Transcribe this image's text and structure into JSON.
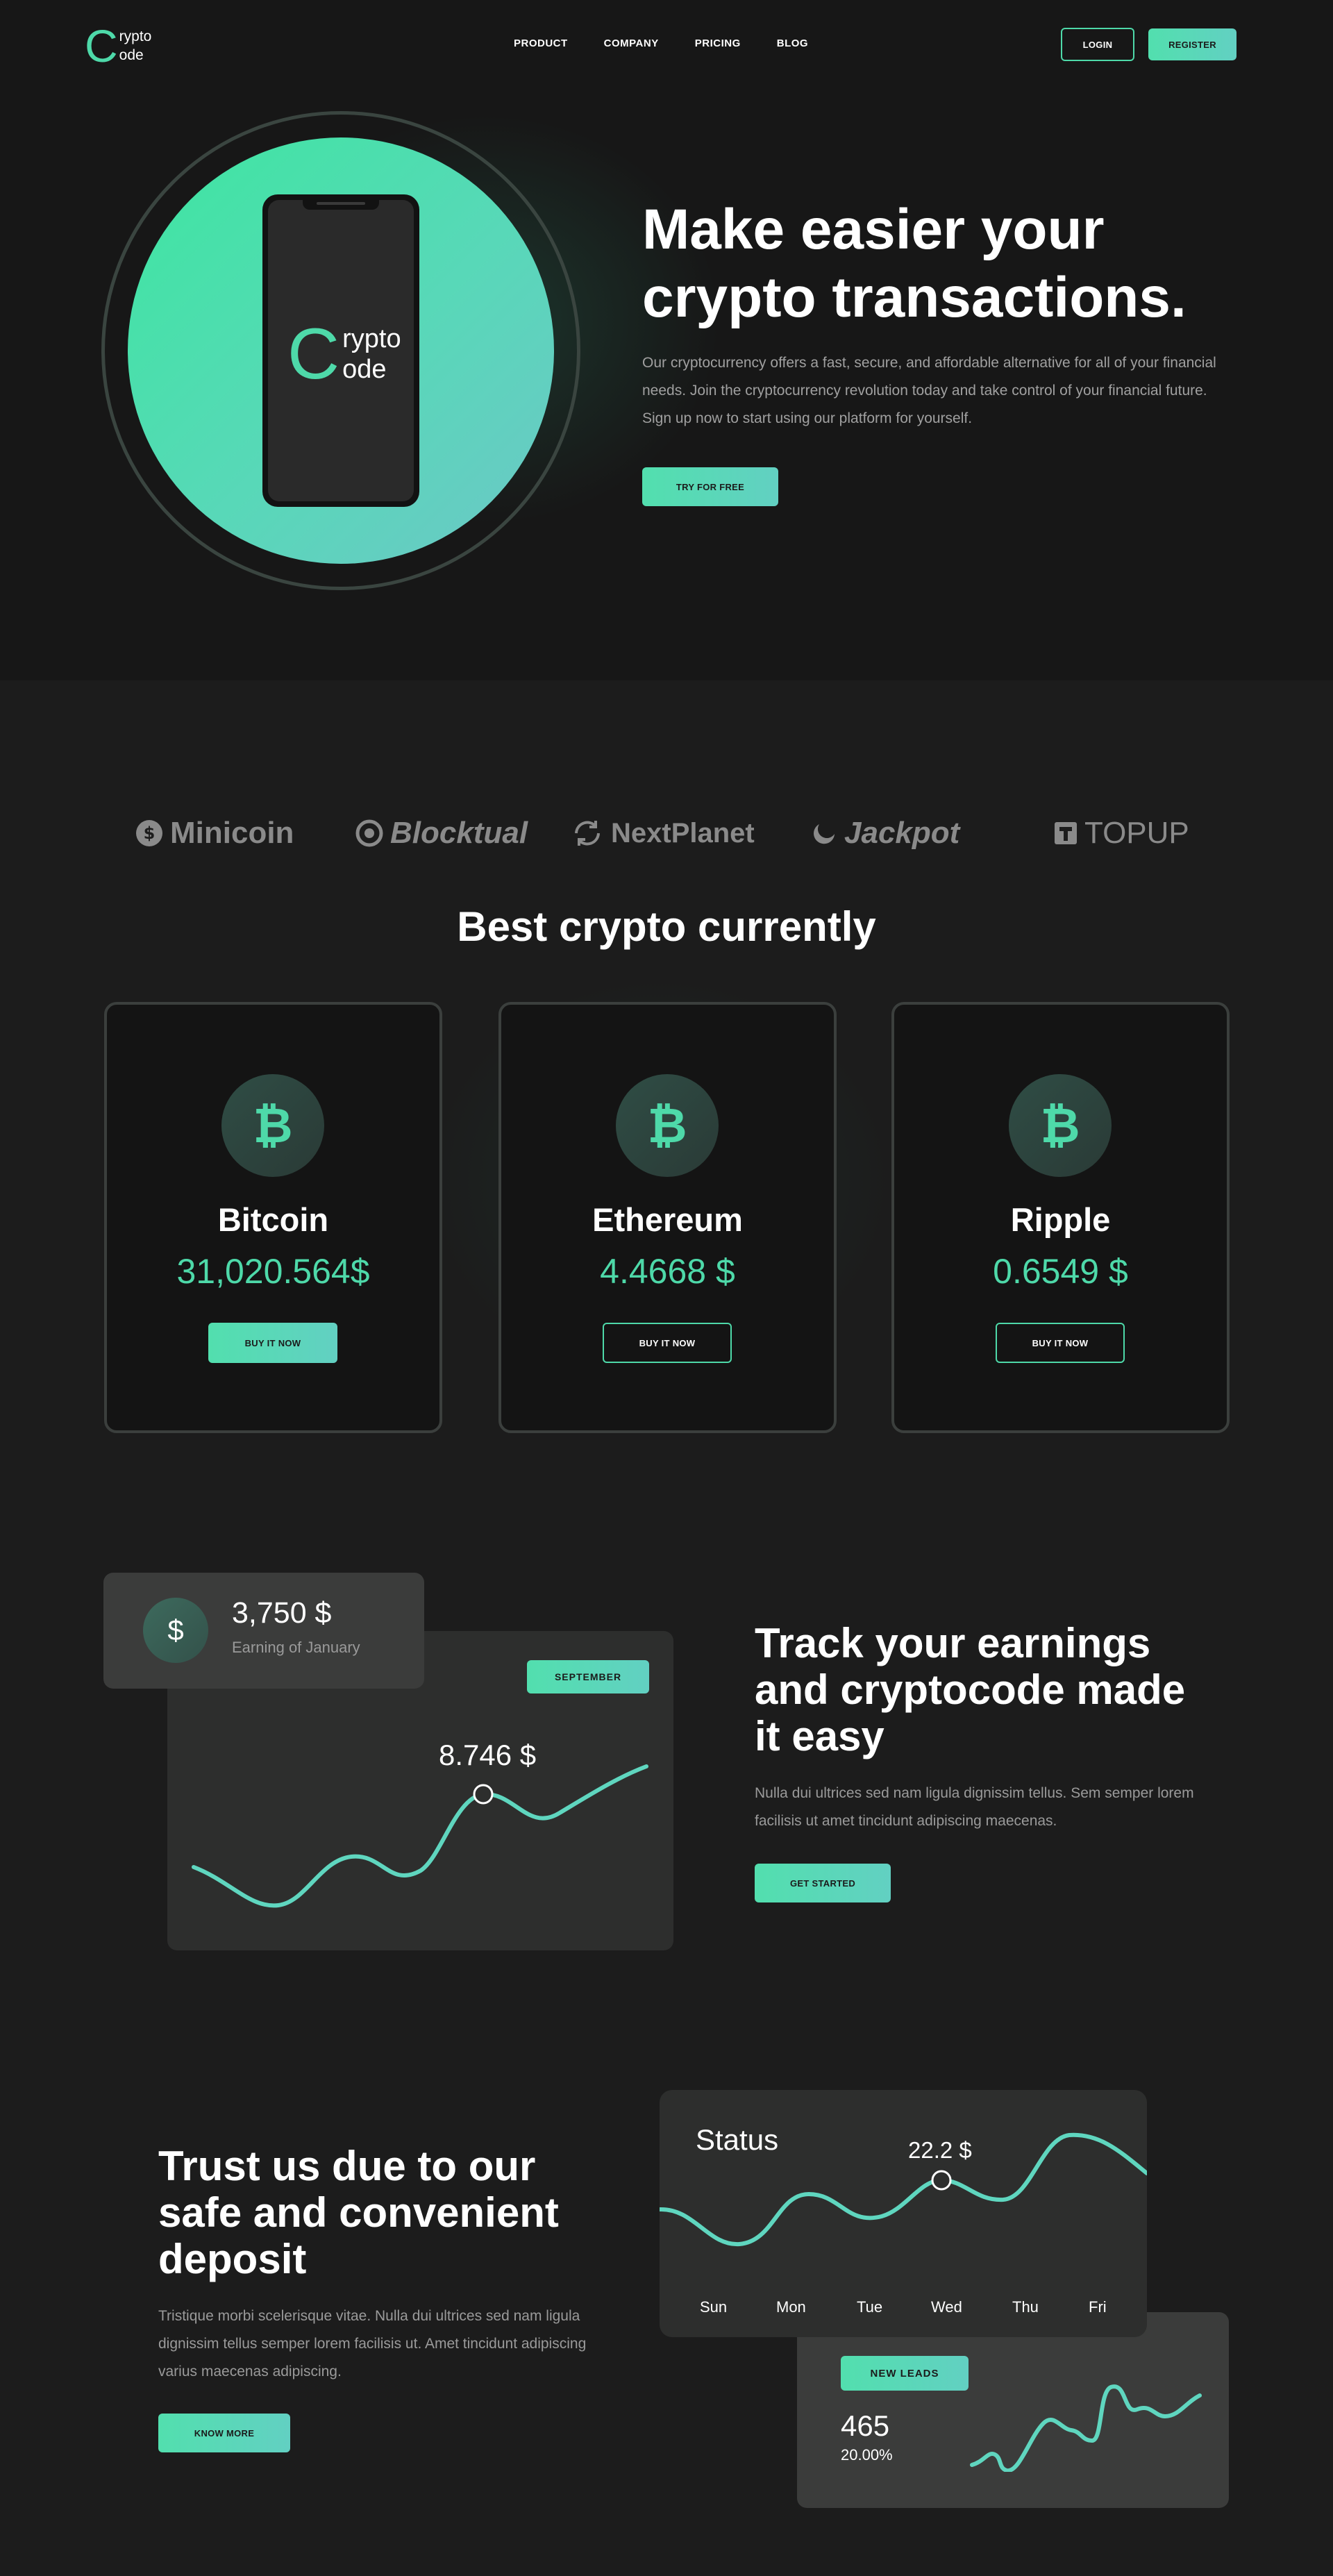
{
  "header": {
    "logo_letter": "C",
    "logo_line1": "rypto",
    "logo_line2": "ode",
    "nav": [
      "PRODUCT",
      "COMPANY",
      "PRICING",
      "BLOG"
    ],
    "login_label": "LOGIN",
    "register_label": "REGISTER"
  },
  "hero": {
    "title_line1": "Make easier your",
    "title_line2": "crypto transactions.",
    "description": "Our cryptocurrency offers a fast, secure, and affordable alternative for all of your financial needs. Join the cryptocurrency revolution today and take control of your financial future. Sign up now to start using our platform for yourself.",
    "cta_label": "TRY FOR FREE",
    "phone_logo_letter": "C",
    "phone_logo_line1": "rypto",
    "phone_logo_line2": "ode"
  },
  "partners": [
    "Minicoin",
    "Blocktual",
    "NextPlanet",
    "Jackpot",
    "TOPUP"
  ],
  "best_crypto": {
    "title": "Best crypto currently",
    "cards": [
      {
        "icon": "bitcoin-icon",
        "glyph": "₿",
        "name": "Bitcoin",
        "price": "31,020.564$",
        "button": "BUY IT NOW",
        "button_style": "solid"
      },
      {
        "icon": "bitcoin-icon",
        "glyph": "₿",
        "name": "Ethereum",
        "price": "4.4668 $",
        "button": "BUY IT NOW",
        "button_style": "outline"
      },
      {
        "icon": "bitcoin-icon",
        "glyph": "₿",
        "name": "Ripple",
        "price": "0.6549 $",
        "button": "BUY IT NOW",
        "button_style": "outline"
      }
    ]
  },
  "earnings": {
    "card_icon": "dollar-icon",
    "card_glyph": "$",
    "card_amount": "3,750 $",
    "card_label": "Earning of January",
    "chart_tag": "SEPTEMBER",
    "chart_point_label": "8.746 $",
    "title_line1": "Track your earnings",
    "title_line2": "and cryptocode made",
    "title_line3": "it easy",
    "description": "Nulla dui ultrices sed nam ligula dignissim tellus. Sem semper lorem facilisis ut amet tincidunt adipiscing maecenas.",
    "cta_label": "GET STARTED"
  },
  "trust": {
    "title_line1": "Trust us due to our",
    "title_line2": "safe and convenient",
    "title_line3": "deposit",
    "description": "Tristique morbi scelerisque vitae. Nulla dui ultrices sed nam ligula dignissim tellus semper lorem facilisis ut. Amet tincidunt adipiscing varius maecenas adipiscing.",
    "cta_label": "KNOW MORE",
    "status_title": "Status",
    "status_point_label": "22.2 $",
    "days": [
      "Sun",
      "Mon",
      "Tue",
      "Wed",
      "Thu",
      "Fri"
    ],
    "leads_tag": "NEW LEADS",
    "leads_value": "465",
    "leads_percent": "20.00%"
  },
  "colors": {
    "accent": "#4ed9a9",
    "background": "#1c1c1c",
    "hero_background": "#171717",
    "card_background": "#141414"
  }
}
